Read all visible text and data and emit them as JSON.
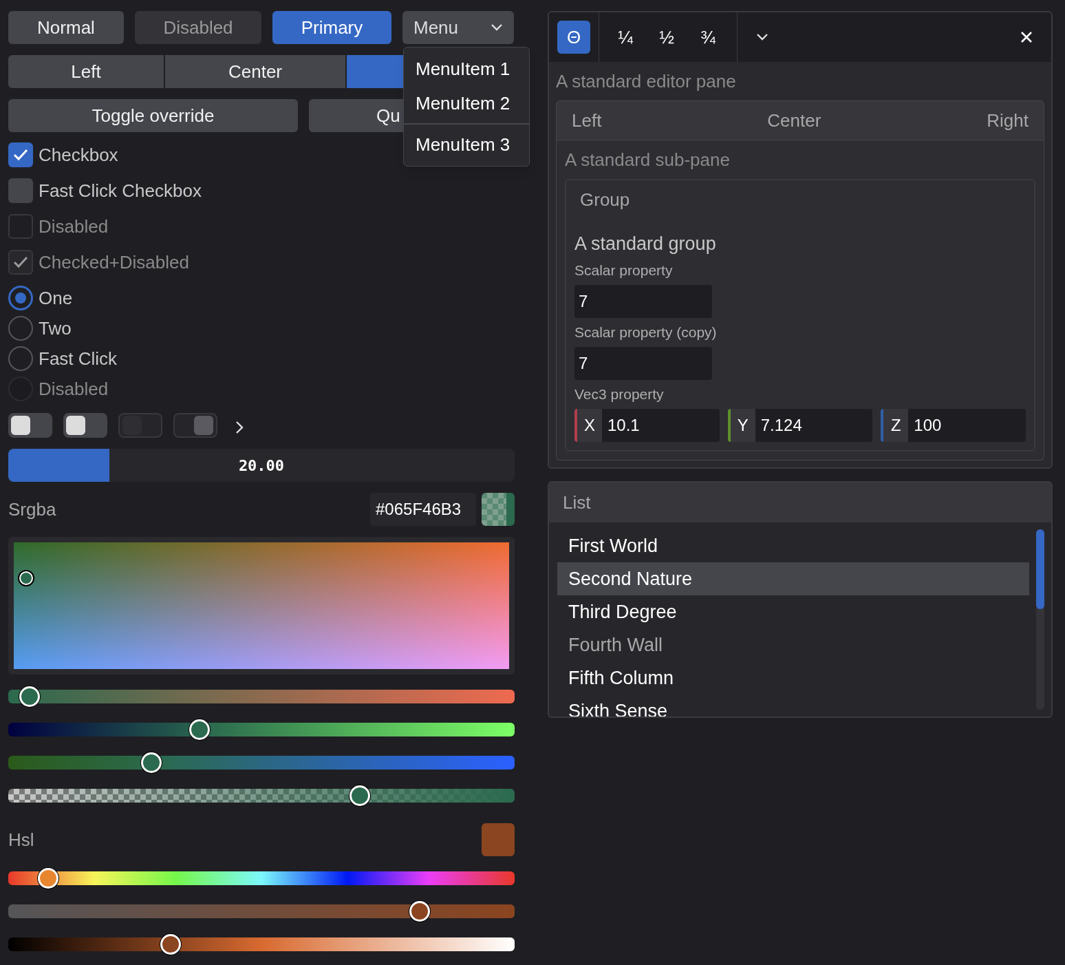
{
  "buttons": [
    {
      "label": "Normal",
      "kind": "normal"
    },
    {
      "label": "Disabled",
      "kind": "disabled"
    },
    {
      "label": "Primary",
      "kind": "primary"
    }
  ],
  "menu_button": {
    "label": "Menu",
    "expanded": true
  },
  "menu": {
    "items": [
      {
        "label": "MenuItem 1",
        "separator_before": false
      },
      {
        "label": "MenuItem 2",
        "separator_before": false
      },
      {
        "label": "MenuItem 3",
        "separator_before": true
      }
    ]
  },
  "segments": [
    {
      "label": "Left",
      "selected": false
    },
    {
      "label": "Center",
      "selected": false
    },
    {
      "selected": true
    }
  ],
  "wide_buttons": [
    {
      "label": "Toggle override"
    },
    {
      "label": "Qu"
    }
  ],
  "checkboxes": [
    {
      "label": "Checkbox",
      "checked": true,
      "disabled": false
    },
    {
      "label": "Fast Click Checkbox",
      "checked": false,
      "disabled": false
    },
    {
      "label": "Disabled",
      "checked": false,
      "disabled": true
    },
    {
      "label": "Checked+Disabled",
      "checked": true,
      "disabled": true
    }
  ],
  "radios": [
    {
      "label": "One",
      "selected": true,
      "disabled": false
    },
    {
      "label": "Two",
      "selected": false,
      "disabled": false
    },
    {
      "label": "Fast Click",
      "selected": false,
      "disabled": false
    },
    {
      "label": "Disabled",
      "selected": false,
      "disabled": true
    }
  ],
  "switches": [
    {
      "on": false,
      "disabled": false
    },
    {
      "on": false,
      "disabled": false
    },
    {
      "on": false,
      "disabled": true
    },
    {
      "on": true,
      "disabled": true
    }
  ],
  "progress": {
    "level": 0.2,
    "reading": "20.00"
  },
  "srgba": {
    "label": "Srgba",
    "hex": "#065F46B3",
    "color": "#2b6a4e",
    "sliders": [
      {
        "kind": "red",
        "level": 0.042
      },
      {
        "kind": "green",
        "level": 0.378
      },
      {
        "kind": "blue",
        "level": 0.283
      },
      {
        "kind": "alpha",
        "level": 0.694
      }
    ]
  },
  "hsl": {
    "label": "Hsl",
    "color": "#8b4520",
    "sliders": [
      {
        "kind": "hue",
        "level": 0.079
      },
      {
        "kind": "saturation",
        "level": 0.812
      },
      {
        "kind": "lightness",
        "level": 0.32
      }
    ]
  },
  "editor": {
    "tabs": [
      {
        "label": "Θ",
        "selected": true
      },
      {
        "label": "¼",
        "selected": false
      },
      {
        "label": "½",
        "selected": false
      },
      {
        "label": "¾",
        "selected": false
      }
    ],
    "title": "A standard editor pane",
    "header": [
      "Left",
      "Center",
      "Right"
    ],
    "subpane_title": "A standard sub-pane",
    "group": {
      "header": "Group",
      "title": "A standard group",
      "fields": [
        {
          "kind": "scalar",
          "label": "Scalar property",
          "value": "7"
        },
        {
          "kind": "scalar",
          "label": "Scalar property (copy)",
          "value": "7"
        },
        {
          "kind": "vec3",
          "label": "Vec3 property",
          "components": [
            {
              "axis": "X",
              "value": "10.1",
              "color": "#b13e4c"
            },
            {
              "axis": "Y",
              "value": "7.124",
              "color": "#5e8f2c"
            },
            {
              "axis": "Z",
              "value": "100",
              "color": "#2f5fa5"
            }
          ]
        }
      ]
    }
  },
  "list": {
    "title": "List",
    "items": [
      {
        "label": "First World",
        "selected": false,
        "disabled": false
      },
      {
        "label": "Second Nature",
        "selected": true,
        "disabled": false
      },
      {
        "label": "Third Degree",
        "selected": false,
        "disabled": false
      },
      {
        "label": "Fourth Wall",
        "selected": false,
        "disabled": true
      },
      {
        "label": "Fifth Column",
        "selected": false,
        "disabled": false
      },
      {
        "label": "Sixth Sense",
        "selected": false,
        "disabled": false
      }
    ]
  }
}
